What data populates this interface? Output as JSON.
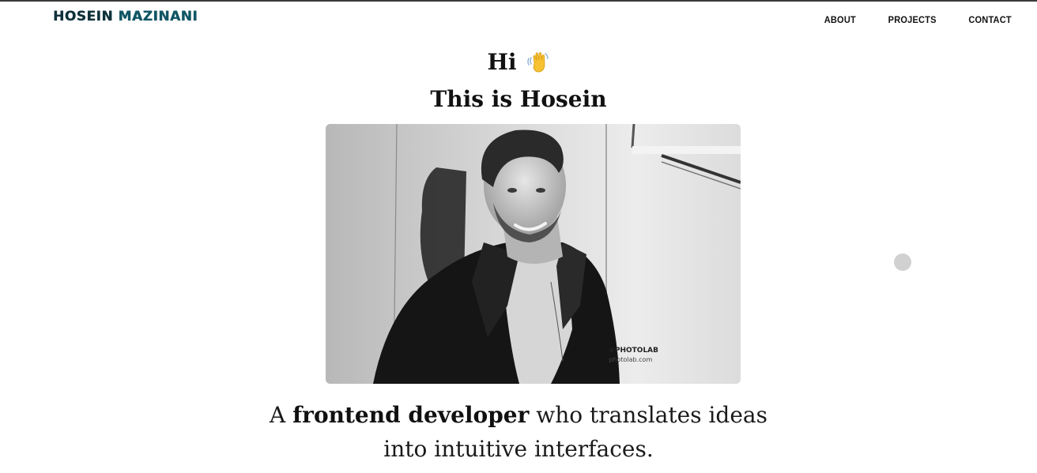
{
  "header": {
    "brand_first": "HOSEIN",
    "brand_last": "MAZINANI",
    "nav": [
      {
        "label": "ABOUT"
      },
      {
        "label": "PROJECTS"
      },
      {
        "label": "CONTACT"
      }
    ]
  },
  "hero": {
    "greeting": "Hi",
    "greeting_icon": "waving-hand-icon",
    "subtitle": "This is Hosein",
    "photo_watermark": "#PHOTOLAB",
    "photo_watermark_url": "photolab.com",
    "tagline_prefix": "A",
    "tagline_bold": "frontend developer",
    "tagline_suffix": "who translates ideas",
    "tagline_line2": "into intuitive interfaces."
  },
  "colors": {
    "brand": "#0e3a47",
    "text": "#111111",
    "background": "#ffffff",
    "cursor": "#cfcfcf"
  }
}
